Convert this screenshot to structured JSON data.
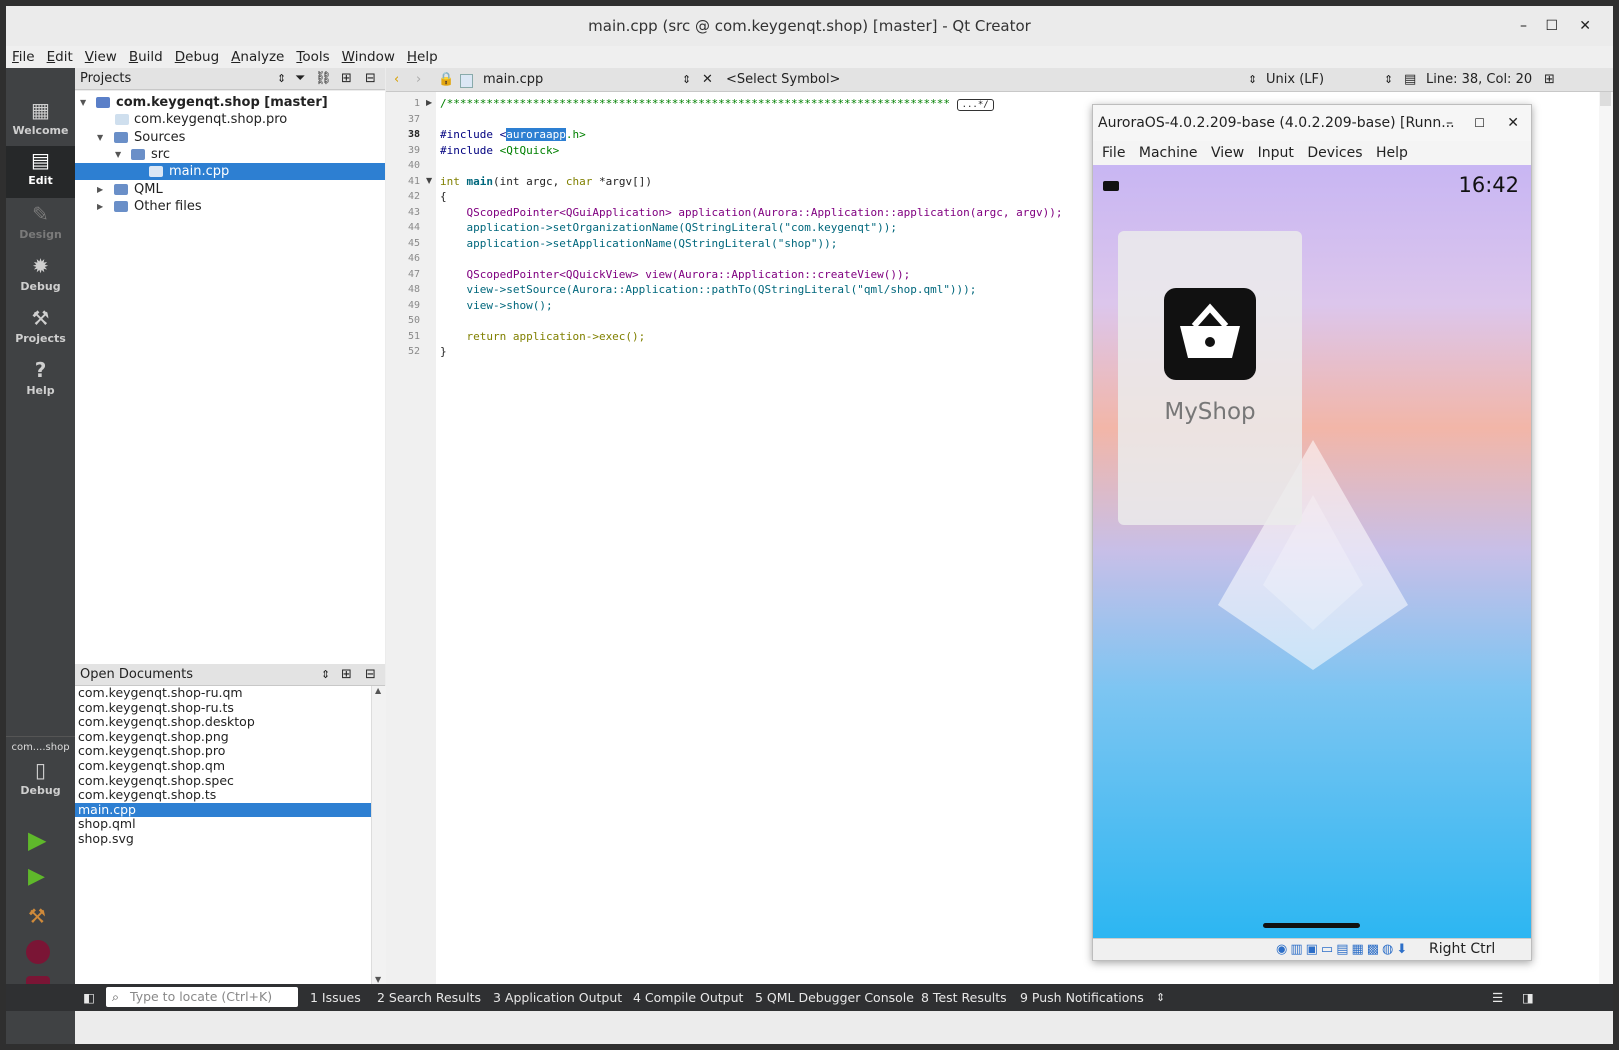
{
  "window": {
    "title": "main.cpp (src @ com.keygenqt.shop) [master] - Qt Creator"
  },
  "menu": [
    "File",
    "Edit",
    "View",
    "Build",
    "Debug",
    "Analyze",
    "Tools",
    "Window",
    "Help"
  ],
  "modes": [
    {
      "label": "Welcome",
      "icon": "grid-icon"
    },
    {
      "label": "Edit",
      "icon": "document-icon"
    },
    {
      "label": "Design",
      "icon": "pencil-icon"
    },
    {
      "label": "Debug",
      "icon": "bug-icon"
    },
    {
      "label": "Projects",
      "icon": "wrench-icon"
    },
    {
      "label": "Help",
      "icon": "help-icon"
    }
  ],
  "kit": {
    "name": "com....shop",
    "mode": "Debug"
  },
  "projects_panel": {
    "title": "Projects"
  },
  "tree": [
    {
      "label": "com.keygenqt.shop [master]"
    },
    {
      "label": "com.keygenqt.shop.pro"
    },
    {
      "label": "Sources"
    },
    {
      "label": "src"
    },
    {
      "label": "main.cpp"
    },
    {
      "label": "QML"
    },
    {
      "label": "Other files"
    }
  ],
  "open_documents": {
    "title": "Open Documents",
    "items": [
      "com.keygenqt.shop-ru.qm",
      "com.keygenqt.shop-ru.ts",
      "com.keygenqt.shop.desktop",
      "com.keygenqt.shop.png",
      "com.keygenqt.shop.pro",
      "com.keygenqt.shop.qm",
      "com.keygenqt.shop.spec",
      "com.keygenqt.shop.ts",
      "main.cpp",
      "shop.qml",
      "shop.svg"
    ]
  },
  "editor": {
    "file": "main.cpp",
    "symbol": "<Select Symbol>",
    "line_ending": "Unix (LF)",
    "position": "Line: 38, Col: 20",
    "line_numbers": [
      "1",
      "37",
      "38",
      "39",
      "40",
      "41",
      "42",
      "43",
      "44",
      "45",
      "46",
      "47",
      "48",
      "49",
      "50",
      "51",
      "52"
    ],
    "folded_comment": "/****************************************************************************",
    "fold_marker": "...*/",
    "include1_pre": "#include <",
    "include1_sel": "auroraapp",
    "include1_post": ".h>",
    "include2_pre": "#include ",
    "include2_lib": "<QtQuick>",
    "main_int": "int ",
    "main_name": "main",
    "main_args_a": "(int argc, ",
    "main_args_b": "char",
    "main_args_c": " *argv[])",
    "brace_open": "{",
    "l43": "    QScopedPointer<QGuiApplication> application(Aurora::Application::application(argc, argv));",
    "l44": "    application->setOrganizationName(QStringLiteral(\"com.keygenqt\"));",
    "l45": "    application->setApplicationName(QStringLiteral(\"shop\"));",
    "l47": "    QScopedPointer<QQuickView> view(Aurora::Application::createView());",
    "l48": "    view->setSource(Aurora::Application::pathTo(QStringLiteral(\"qml/shop.qml\")));",
    "l49": "    view->show();",
    "l51": "    return application->exec();",
    "brace_close": "}"
  },
  "bottom": {
    "locate_placeholder": "Type to locate (Ctrl+K)",
    "tabs": [
      "1  Issues",
      "2  Search Results",
      "3  Application Output",
      "4  Compile Output",
      "5  QML Debugger Console",
      "8  Test Results",
      "9  Push Notifications"
    ]
  },
  "vm": {
    "title": "AuroraOS-4.0.2.209-base (4.0.2.209-base) [Runn...",
    "menu": [
      "File",
      "Machine",
      "View",
      "Input",
      "Devices",
      "Help"
    ],
    "time": "16:42",
    "app_name": "MyShop",
    "host_key": "Right Ctrl"
  },
  "colors": {
    "accent": "#2d7fd2",
    "modebar": "#404244",
    "bottombar": "#2f3032",
    "keyword": "#808000",
    "type": "#800080",
    "string": "#008000",
    "comment": "#008000"
  }
}
